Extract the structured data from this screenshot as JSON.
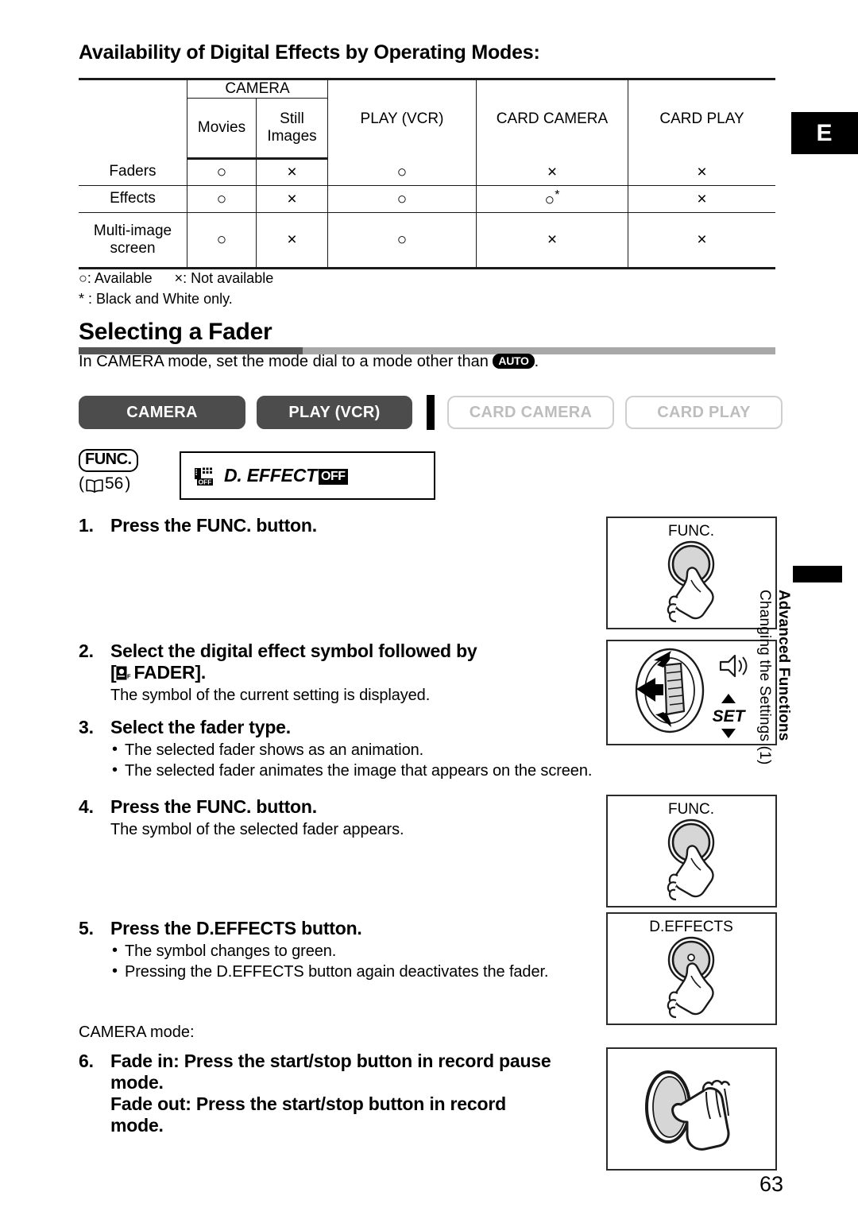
{
  "page": {
    "edition_tab": "E",
    "number": "63",
    "side_tab": {
      "line1": "Advanced Functions",
      "line2": "Changing the Settings (1)"
    }
  },
  "availability": {
    "title": "Availability of Digital Effects by Operating Modes:",
    "columns": {
      "group": "CAMERA",
      "sub1": "Movies",
      "sub2_line1": "Still",
      "sub2_line2": "Images",
      "play": "PLAY (VCR)",
      "card_camera": "CARD CAMERA",
      "card_play": "CARD PLAY"
    },
    "rows": [
      {
        "label": "Faders",
        "movies": "○",
        "still": "×",
        "play": "○",
        "card_camera": "×",
        "card_play": "×",
        "card_camera_star": ""
      },
      {
        "label": "Effects",
        "movies": "○",
        "still": "×",
        "play": "○",
        "card_camera": "○",
        "card_play": "×",
        "card_camera_star": "*"
      },
      {
        "label_line1": "Multi-image",
        "label_line2": "screen",
        "label": "Multi-image screen",
        "movies": "○",
        "still": "×",
        "play": "○",
        "card_camera": "×",
        "card_play": "×",
        "card_camera_star": ""
      }
    ],
    "legend_available": "○: Available",
    "legend_not_available": "×: Not available",
    "legend_footnote": "* : Black and White only."
  },
  "section": {
    "heading": "Selecting a Fader",
    "intro_before": "In CAMERA mode, set the mode dial to a mode other than",
    "intro_badge": "AUTO",
    "intro_after": "."
  },
  "mode_badges": [
    {
      "label": "CAMERA",
      "state": "active"
    },
    {
      "label": "PLAY (VCR)",
      "state": "active"
    },
    {
      "label": "CARD CAMERA",
      "state": "inactive"
    },
    {
      "label": "CARD PLAY",
      "state": "inactive"
    }
  ],
  "func_reference": {
    "button": "FUNC.",
    "page_ref": "56",
    "open_paren": "(",
    "close_paren": ")",
    "menu_label": "D. EFFECT",
    "menu_value": "OFF"
  },
  "steps": [
    {
      "num": "1.",
      "title": "Press the FUNC. button.",
      "note": "",
      "bullets": []
    },
    {
      "num": "2.",
      "title_line1": "Select the digital effect symbol followed by",
      "title_line2_prefix": "[",
      "title_line2_suffix": "FADER].",
      "note": "The symbol of the current setting is displayed.",
      "bullets": []
    },
    {
      "num": "3.",
      "title": "Select the fader type.",
      "note": "",
      "bullets": [
        "The selected fader shows as an animation.",
        "The selected fader animates the image that appears on the screen."
      ]
    },
    {
      "num": "4.",
      "title": "Press the FUNC. button.",
      "note": "The symbol of the selected fader appears.",
      "bullets": []
    },
    {
      "num": "5.",
      "title": "Press the D.EFFECTS button.",
      "note": "",
      "bullets": [
        "The symbol changes to green.",
        "Pressing the D.EFFECTS button again deactivates the fader."
      ]
    },
    {
      "num": "6.",
      "title_line1": "Fade in: Press the start/stop button in record pause",
      "title_line2": "mode.",
      "title_line3": "Fade out: Press the start/stop button in record",
      "title_line4": "mode.",
      "note": "",
      "bullets": []
    }
  ],
  "camera_mode_caption": "CAMERA mode:",
  "illustrations": [
    {
      "name": "func-button",
      "label": "FUNC."
    },
    {
      "name": "joystick-dial",
      "label": "SET"
    },
    {
      "name": "func-button-2",
      "label": "FUNC."
    },
    {
      "name": "deffects-button",
      "label": "D.EFFECTS"
    },
    {
      "name": "start-stop-button",
      "label": ""
    }
  ],
  "colors": {
    "badge_active_bg": "#4c4c4c",
    "badge_inactive_border": "#cfcfcf",
    "heading_rule": "#a8a8a8",
    "ink": "#000000"
  }
}
